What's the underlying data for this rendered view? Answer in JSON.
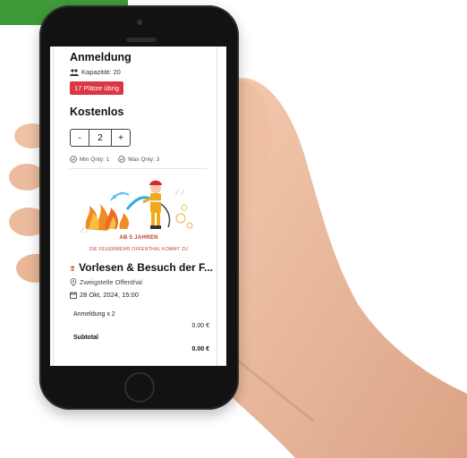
{
  "registration": {
    "title": "Anmeldung",
    "capacity": "Kapazität: 20",
    "spots_left": "17 Plätze übrig"
  },
  "ticket": {
    "price": "Kostenlos",
    "minus": "-",
    "quantity": "2",
    "plus": "+",
    "min_qty": "Min Qnty: 1",
    "max_qty": "Max Qnty: 3"
  },
  "poster": {
    "age": "AB 5 JAHREN",
    "subtitle": "DIE FEUERWEHR OFFENTHAL KOMMT ZU"
  },
  "event": {
    "title": "Vorlesen & Besuch der F...",
    "location": "Zweigstelle Offenthal",
    "datetime": "28 Okt, 2024, 15:00"
  },
  "summary": {
    "item_label": "Anmeldung x 2",
    "item_value": "0.00 €",
    "subtotal_label": "Subtotal",
    "subtotal_value": "0.00 €"
  },
  "colors": {
    "badge": "#dc3545",
    "corner_tab": "#3f9a3a"
  }
}
